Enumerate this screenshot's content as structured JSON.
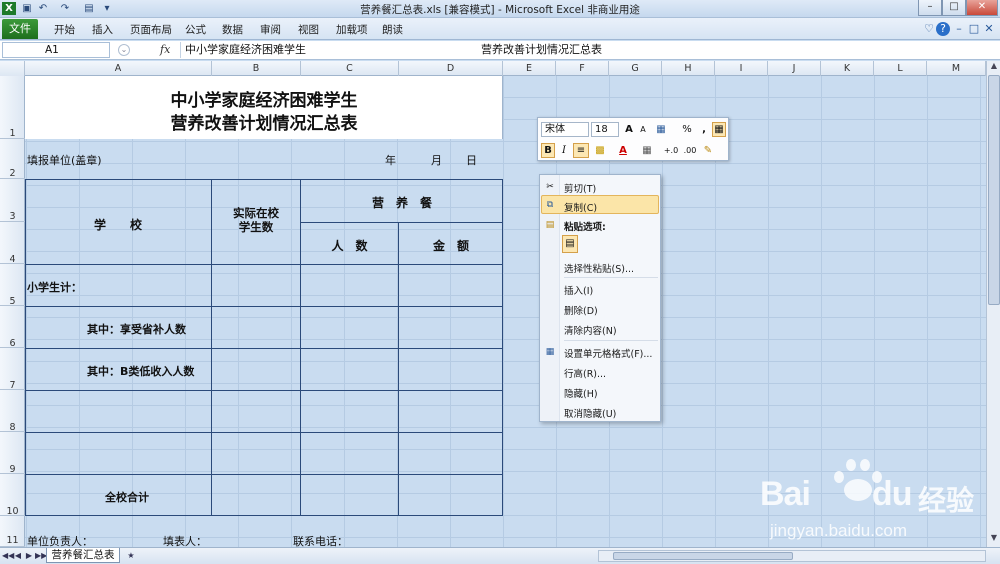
{
  "window": {
    "title": "营养餐汇总表.xls [兼容模式] - Microsoft Excel 非商业用途",
    "quick_access": [
      "excel-logo-icon",
      "save-icon",
      "undo-icon",
      "redo-icon",
      "print-preview-icon",
      "customize-icon"
    ]
  },
  "ribbon": {
    "file_tab": "文件",
    "tabs": [
      "开始",
      "插入",
      "页面布局",
      "公式",
      "数据",
      "审阅",
      "视图",
      "加载项",
      "朗读"
    ]
  },
  "formula_bar": {
    "name_box": "A1",
    "fx": "fx",
    "content_line1": "中小学家庭经济困难学生",
    "content_line2": "营养改善计划情况汇总表"
  },
  "columns": [
    "A",
    "B",
    "C",
    "D",
    "E",
    "F",
    "G",
    "H",
    "I",
    "J",
    "K",
    "L",
    "M"
  ],
  "rows": [
    "1",
    "2",
    "3",
    "4",
    "5",
    "6",
    "7",
    "8",
    "9",
    "10",
    "11"
  ],
  "sheet": {
    "title_line1": "中小学家庭经济困难学生",
    "title_line2": "营养改善计划情况汇总表",
    "unit_label": "填报单位(盖章)",
    "year": "年",
    "month": "月",
    "day": "日",
    "header_school": "学　　校",
    "header_enrolled": "实际在校\n学生数",
    "header_meal": "营　养　餐",
    "header_count": "人　数",
    "header_amount": "金　额",
    "row_primary": "小学生计：",
    "row_sub1": "其中：享受省补人数",
    "row_sub2": "其中：B类低收入人数",
    "row_total": "全校合计",
    "footer_person": "单位负责人：",
    "footer_filler": "填表人：",
    "footer_phone": "联系电话："
  },
  "sheet_tabs": [
    "营养餐汇总表"
  ],
  "mini_toolbar": {
    "font": "宋体",
    "size": "18",
    "buttons_row1": [
      "A▲",
      "A▼",
      "格式",
      "%",
      ","
    ],
    "buttons_row2": [
      "B",
      "I",
      "居中",
      "填充",
      "A",
      "边框",
      "+.0",
      ".00",
      "刷"
    ]
  },
  "context_menu": {
    "items": [
      {
        "label": "剪切(T)",
        "icon": "scissors-icon"
      },
      {
        "label": "复制(C)",
        "icon": "copy-icon",
        "highlighted": true
      },
      {
        "label": "粘贴选项:",
        "icon": "paste-icon",
        "bold": true
      },
      {
        "label": "选择性粘贴(S)...",
        "icon": ""
      },
      {
        "label": "插入(I)",
        "icon": ""
      },
      {
        "label": "删除(D)",
        "icon": ""
      },
      {
        "label": "清除内容(N)",
        "icon": ""
      },
      {
        "label": "设置单元格格式(F)...",
        "icon": "format-cells-icon"
      },
      {
        "label": "行高(R)...",
        "icon": ""
      },
      {
        "label": "隐藏(H)",
        "icon": ""
      },
      {
        "label": "取消隐藏(U)",
        "icon": ""
      }
    ]
  },
  "watermark": {
    "brand": "Bai",
    "brand2": "du",
    "cn": "经验",
    "url": "jingyan.baidu.com"
  },
  "colors": {
    "cell_selection": "#c9dcf0",
    "table_border": "#2b4a7a",
    "excel_green": "#1d6f1d",
    "menu_highlight": "#fbe5a8"
  }
}
